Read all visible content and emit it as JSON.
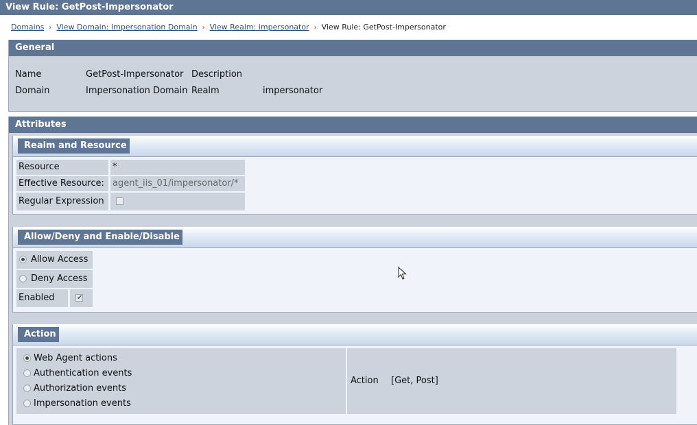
{
  "window": {
    "title": "View Rule: GetPost-Impersonator"
  },
  "breadcrumb": {
    "items": [
      "Domains",
      "View Domain: Impersonation Domain",
      "View Realm: impersonator"
    ],
    "current": "View Rule: GetPost-Impersonator",
    "separator": "›"
  },
  "general": {
    "header": "General",
    "name_label": "Name",
    "name_value": "GetPost-Impersonator",
    "description_label": "Description",
    "description_value": "",
    "domain_label": "Domain",
    "domain_value": "Impersonation Domain",
    "realm_label": "Realm",
    "realm_value": "impersonator"
  },
  "attributes": {
    "header": "Attributes",
    "realm_resource": {
      "title": "Realm and Resource",
      "resource_label": "Resource",
      "resource_value": "*",
      "effective_label": "Effective Resource:",
      "effective_value": "agent_iis_01/impersonator/*",
      "regex_label": "Regular Expression",
      "regex_checked": false
    },
    "allow_deny": {
      "title": "Allow/Deny and Enable/Disable",
      "allow_label": "Allow Access",
      "deny_label": "Deny Access",
      "selected": "allow",
      "enabled_label": "Enabled",
      "enabled_checked": true
    },
    "action": {
      "title": "Action",
      "options": [
        "Web Agent actions",
        "Authentication events",
        "Authorization events",
        "Impersonation events"
      ],
      "selected_index": 0,
      "action_label": "Action",
      "action_value": "[Get, Post]"
    }
  },
  "colors": {
    "header": "#5f7594",
    "panel_bg": "#ccd3dd",
    "subpanel_bg": "#f0f4fa",
    "link": "#2b4f82"
  },
  "icons": {
    "check": "check-icon",
    "cursor": "mouse-pointer-icon"
  }
}
